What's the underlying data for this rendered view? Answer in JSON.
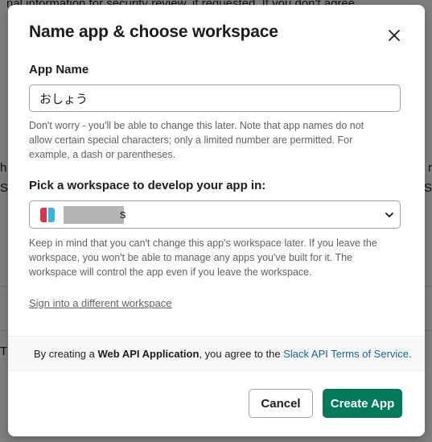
{
  "background": {
    "line1": "nal information for security review, if requested. If you don't agree",
    "line2_left": "h",
    "line3_left": "S",
    "line4_left": "T",
    "right_edge": "r\nvic"
  },
  "modal": {
    "title": "Name app & choose workspace",
    "close_icon": "close-icon",
    "app_name": {
      "label": "App Name",
      "value": "おしょう",
      "help": "Don't worry - you'll be able to change this later. Note that app names do not allow certain special characters; only a limited number are permitted. For example, a dash or parentheses."
    },
    "workspace": {
      "label": "Pick a workspace to develop your app in:",
      "selected_suffix": "s",
      "help": "Keep in mind that you can't change this app's workspace later. If you leave the workspace, you won't be able to manage any apps you've built for it. The workspace will control the app even if you leave the workspace."
    },
    "different_workspace_link": "Sign into a different workspace",
    "terms": {
      "prefix": "By creating a ",
      "bold": "Web API Application",
      "middle": ", you agree to the ",
      "link": "Slack API Terms of Service",
      "suffix": "."
    },
    "cancel_label": "Cancel",
    "create_label": "Create App"
  },
  "colors": {
    "primary_button": "#007a5a",
    "link": "#1264a3"
  }
}
